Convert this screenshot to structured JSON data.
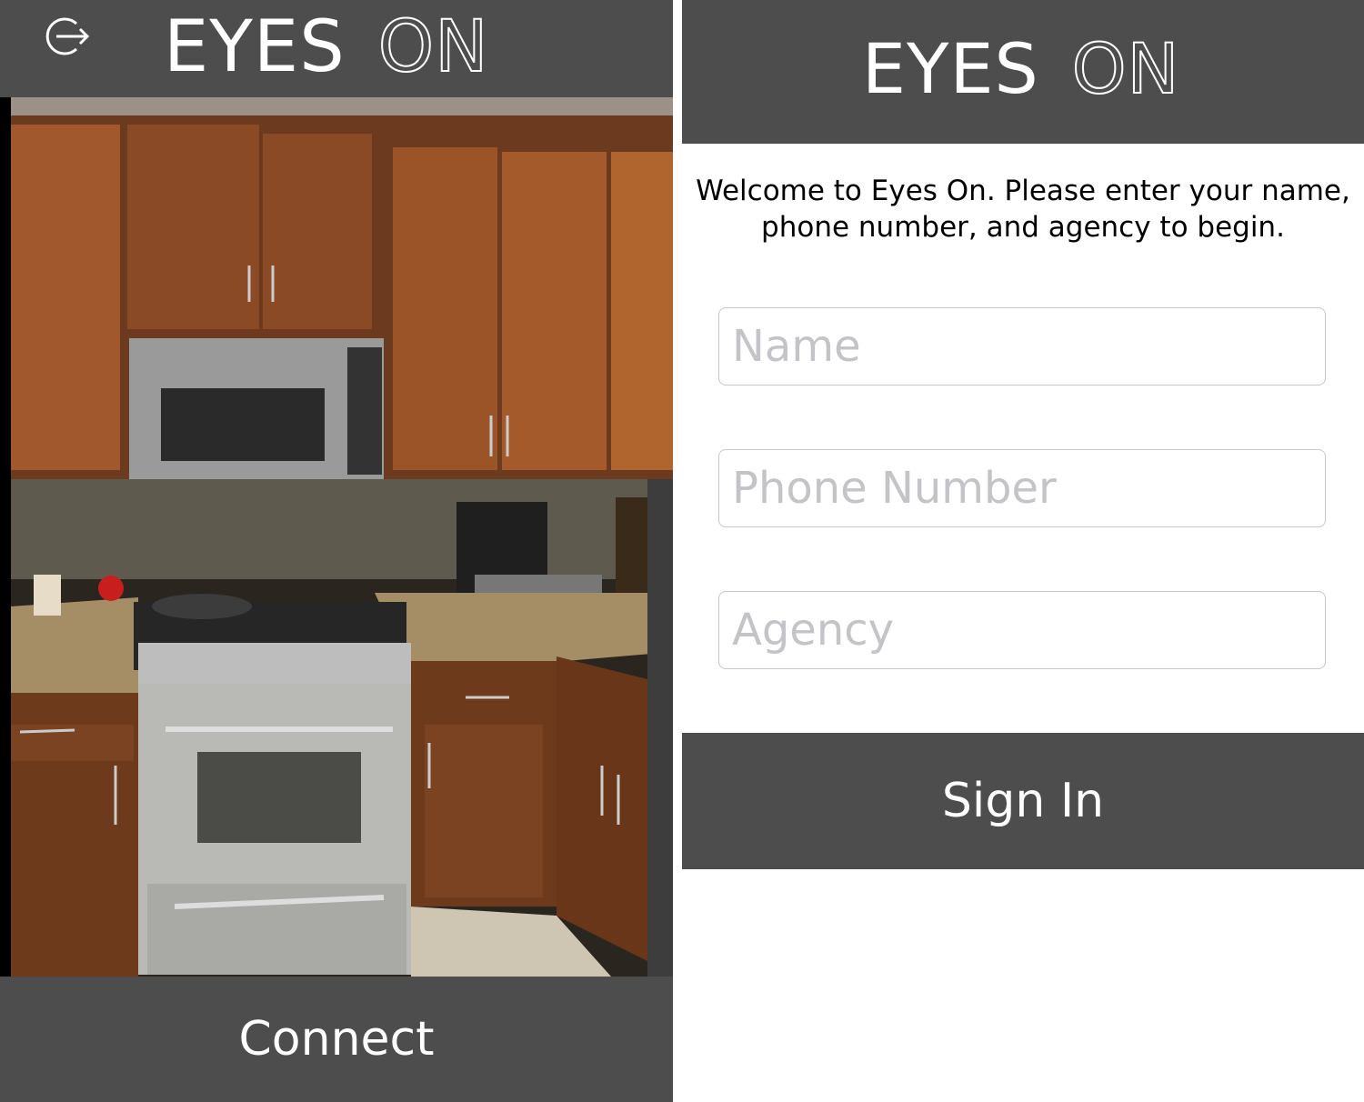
{
  "left_screen": {
    "brand": {
      "word1": "EYES",
      "word2": "ON"
    },
    "exit_icon": "exit-arrow-icon",
    "camera_preview": "kitchen-camera-feed",
    "connect_label": "Connect"
  },
  "right_screen": {
    "brand": {
      "word1": "EYES",
      "word2": "ON"
    },
    "welcome_line1": "Welcome to Eyes On. Please enter your name,",
    "welcome_line2": "phone number, and agency to begin.",
    "fields": {
      "name": {
        "value": "",
        "placeholder": "Name"
      },
      "phone": {
        "value": "",
        "placeholder": "Phone Number"
      },
      "agency": {
        "value": "",
        "placeholder": "Agency"
      }
    },
    "signin_label": "Sign In"
  },
  "colors": {
    "bar": "#4d4d4d",
    "placeholder": "#c4c4c8",
    "field_border": "#c7c7cc"
  }
}
